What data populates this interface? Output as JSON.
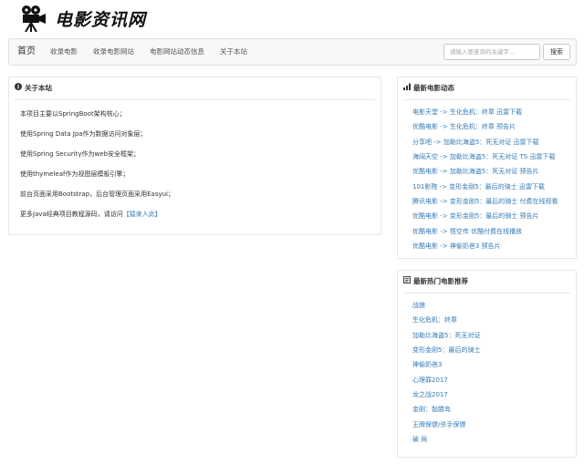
{
  "site": {
    "logo_text": "电影资讯网"
  },
  "nav": {
    "items": [
      "首页",
      "收录电影",
      "收录电影网站",
      "电影网站动态信息",
      "关于本站"
    ]
  },
  "search": {
    "placeholder": "请输入要查询的关键字...",
    "button_label": "搜索"
  },
  "about": {
    "title": "关于本站",
    "lines": [
      "本项目主要以SpringBoot架构核心；",
      "使用Spring Data Jpa作为数据访问对象层；",
      "使用Spring Security作为web安全框架；",
      "使用thymeleaf作为视图层模板引擎；",
      "前台页面采用Bootstrap，后台管理页面采用Easyui；",
      "更多Java经典项目教程源码，请访问"
    ],
    "link_text": "【猿来入此】"
  },
  "latest": {
    "title": "最新电影动态",
    "items": [
      "电影天堂 -> 生化危机：终章 迅雷下载",
      "优酷电影 -> 生化危机：终章 预告片",
      "分享吧 -> 加勒比海盗5：死无对证 迅雷下载",
      "海阔天空 -> 加勒比海盗5：死无对证 TS 迅雷下载",
      "优酷电影 -> 加勒比海盗5：死无对证 预告片",
      "101影院 -> 变形金刚5：最后的骑士 迅雷下载",
      "腾讯电影 -> 变形金刚5：最后的骑士 付费在线观看",
      "优酷电影 -> 变形金刚5：最后的骑士 预告片",
      "优酷电影 -> 悟空传 优酷付费在线播放",
      "优酷电影 -> 神偷奶爸3 预告片"
    ]
  },
  "hot": {
    "title": "最新热门电影推荐",
    "items": [
      "战狼",
      "生化危机：终章",
      "加勒比海盗5：死无对证",
      "变形金刚5：最后的骑士",
      "神偷奶爸3",
      "心理罪2017",
      "龙之战2017",
      "金刚：骷髅岛",
      "王牌保镖/杀手保镖",
      "破 局"
    ]
  },
  "colors": {
    "link": "#337ab7",
    "border": "#e6e6e6",
    "navbar_bg": "#f8f8f8"
  }
}
